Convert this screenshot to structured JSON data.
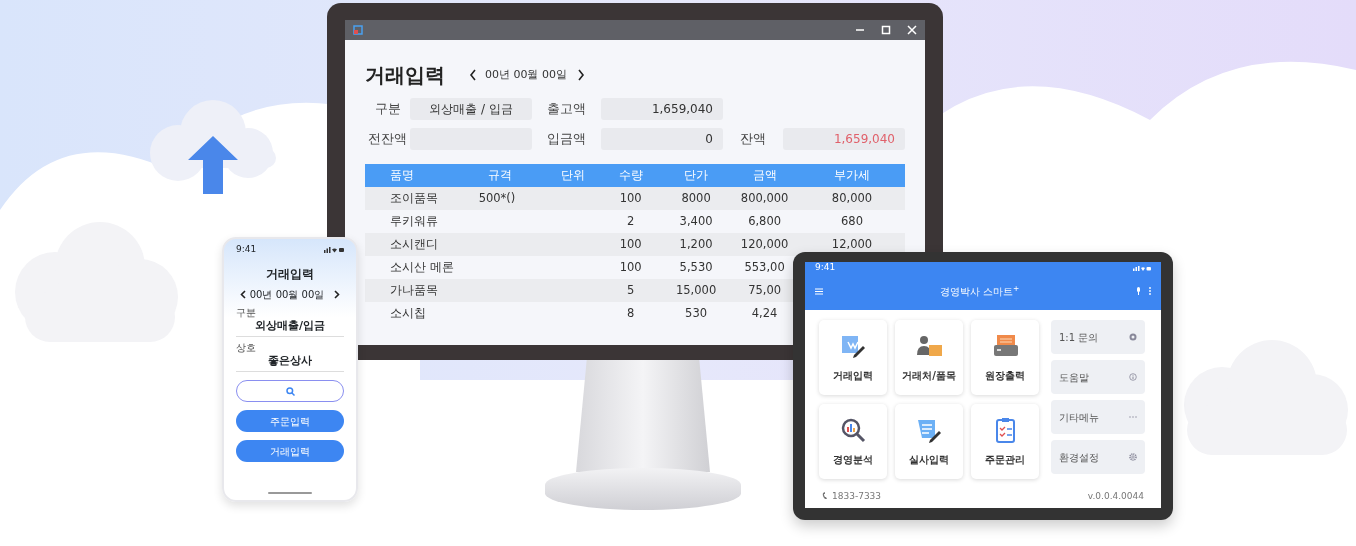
{
  "monitor": {
    "title": "거래입력",
    "date": "00년 00월 00일",
    "fields": [
      {
        "label": "구분",
        "value": "외상매출 / 입금",
        "kind": "text"
      },
      {
        "label": "출고액",
        "value": "1,659,040",
        "kind": "amount"
      },
      {
        "label": "전잔액",
        "kind": "text"
      },
      {
        "label": "입금액",
        "value": "0",
        "kind": "amount"
      },
      {
        "label": "잔액",
        "value": "1,659,040",
        "kind": "alert"
      }
    ],
    "table": {
      "columns": [
        "품명",
        "규격",
        "단위",
        "수량",
        "단가",
        "금액",
        "부가세"
      ],
      "rows": [
        {
          "cells": [
            "조이품목",
            "500*()",
            null,
            "100",
            "8000",
            "800,000",
            "80,000"
          ]
        },
        {
          "cells": [
            "루키워류",
            null,
            null,
            "2",
            "3,400",
            "6,800",
            "680"
          ]
        },
        {
          "cells": [
            "소시캔디",
            null,
            null,
            "100",
            "1,200",
            "120,000",
            "12,000"
          ]
        },
        {
          "cells": [
            "소시산 메론",
            null,
            null,
            "100",
            "5,530",
            "553,00"
          ]
        },
        {
          "cells": [
            "가나품목",
            null,
            null,
            "5",
            "15,000",
            "75,00"
          ]
        },
        {
          "cells": [
            "소시칩",
            null,
            null,
            "8",
            "530",
            "4,24"
          ]
        }
      ]
    }
  },
  "phone": {
    "status_time": "9:41",
    "title": "거래입력",
    "date": "00년 00월 00일",
    "fields": [
      {
        "label": "구분",
        "value": "외상매출/입금"
      },
      {
        "label": "상호",
        "value": "좋은상사"
      }
    ],
    "buttons": [
      "주문입력",
      "거래입력"
    ]
  },
  "tablet": {
    "status_time": "9:41",
    "title": "경영박사 스마트$^{+}$",
    "tiles": [
      {
        "label": "거래입력"
      },
      {
        "label": "거래처/품목"
      },
      {
        "label": "원장출력"
      },
      {
        "label": "경영분석"
      },
      {
        "label": "실사입력"
      },
      {
        "label": "주문관리"
      }
    ],
    "side_menu": [
      {
        "label": "1:1 문의"
      },
      {
        "label": "도움말"
      },
      {
        "label": "기타메뉴"
      },
      {
        "label": "환경설정"
      }
    ],
    "phone_number": "1833-7333",
    "version": "v.0.0.4.0044"
  }
}
